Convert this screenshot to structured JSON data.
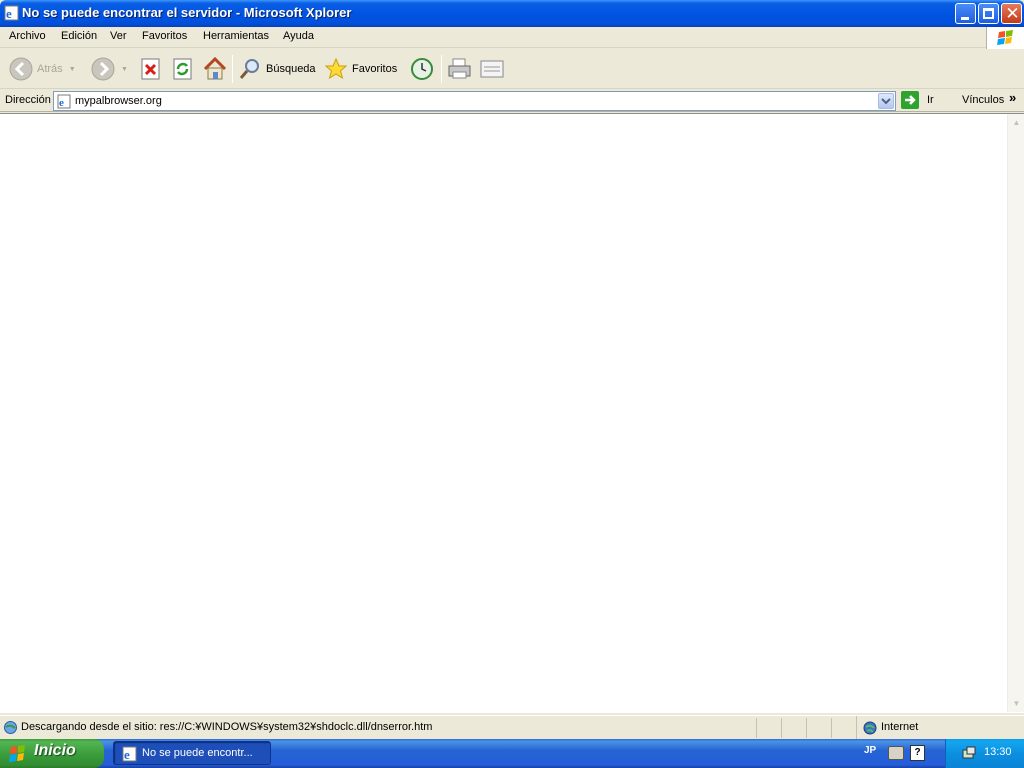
{
  "window": {
    "title": "No se puede encontrar el servidor - Microsoft Xplorer"
  },
  "menu": {
    "items": [
      "Archivo",
      "Edición",
      "Ver",
      "Favoritos",
      "Herramientas",
      "Ayuda"
    ]
  },
  "toolbar": {
    "back_label": "Atrás",
    "search_label": "Búsqueda",
    "favorites_label": "Favoritos"
  },
  "address": {
    "label": "Dirección",
    "url": "mypalbrowser.org",
    "go_label": "Ir",
    "links_label": "Vínculos"
  },
  "status": {
    "text": "Descargando desde el sitio: res://C:¥WINDOWS¥system32¥shdoclc.dll/dnserror.htm",
    "zone": "Internet"
  },
  "taskbar": {
    "start_label": "Inicio",
    "task_label": "No se puede encontr...",
    "language": "JP",
    "clock": "13:30"
  },
  "colors": {
    "titlebar_blue": "#0054e3",
    "start_green": "#3c9e3c",
    "taskbar_blue": "#245edb"
  }
}
